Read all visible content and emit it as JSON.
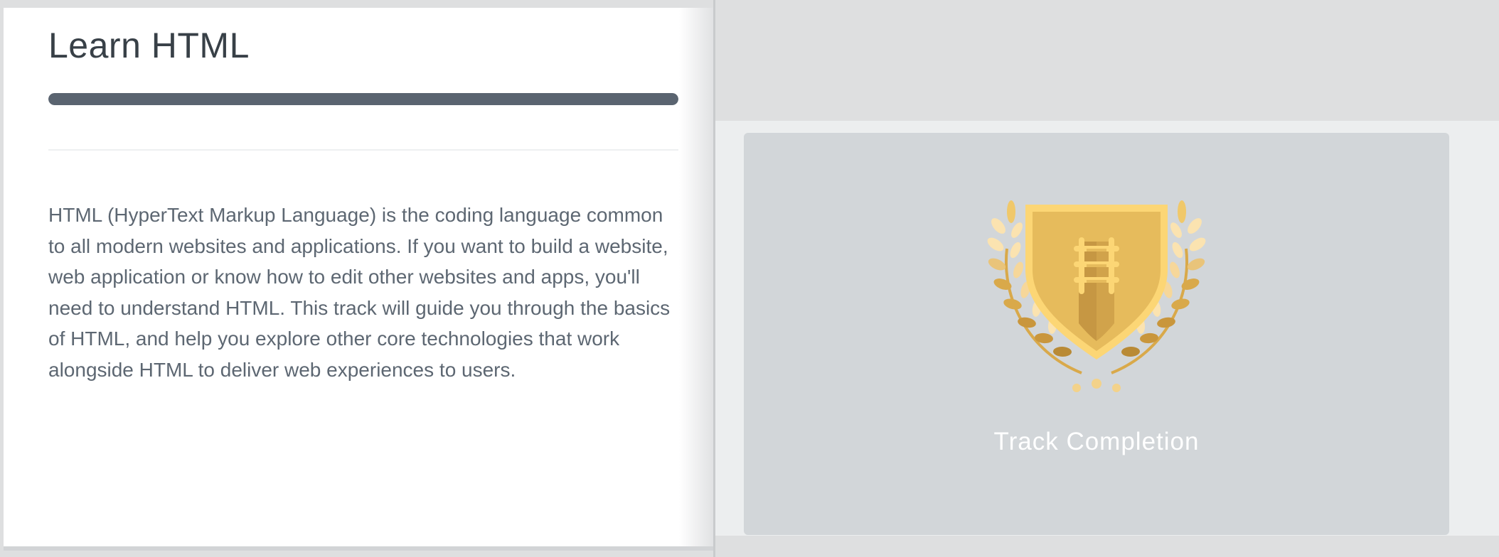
{
  "track": {
    "title": "Learn HTML",
    "progress_percent": 100,
    "description": "HTML (HyperText Markup Language) is the coding language common to all modern websites and applications. If you want to build a website, web application or know how to edit other websites and apps, you'll need to understand HTML. This track will guide you through the basics of HTML, and help you explore other core technologies that work alongside HTML to deliver web experiences to users."
  },
  "badge": {
    "label": "Track Completion",
    "icon": "gold-shield-laurel-badge-icon"
  },
  "colors": {
    "progress_fill": "#5a6470",
    "badge_panel": "#d2d6d9",
    "shield_gold": "#e6bb5c",
    "laurel_gold": "#d9a94a"
  }
}
